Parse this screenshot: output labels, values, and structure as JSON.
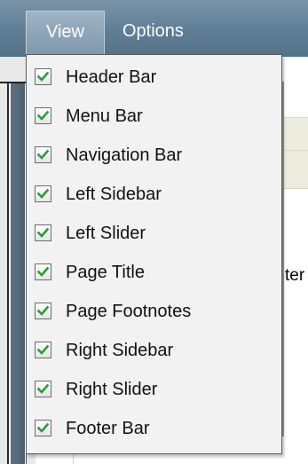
{
  "menubar": {
    "view_label": "View",
    "options_label": "Options"
  },
  "background": {
    "partial_text": "ter"
  },
  "dropdown": {
    "check_color": "#2e9a3a",
    "items": [
      {
        "label": "Header Bar",
        "checked": true
      },
      {
        "label": "Menu Bar",
        "checked": true
      },
      {
        "label": "Navigation Bar",
        "checked": true
      },
      {
        "label": "Left Sidebar",
        "checked": true
      },
      {
        "label": "Left Slider",
        "checked": true
      },
      {
        "label": "Page Title",
        "checked": true
      },
      {
        "label": "Page Footnotes",
        "checked": true
      },
      {
        "label": "Right Sidebar",
        "checked": true
      },
      {
        "label": "Right Slider",
        "checked": true
      },
      {
        "label": "Footer Bar",
        "checked": true
      }
    ]
  }
}
